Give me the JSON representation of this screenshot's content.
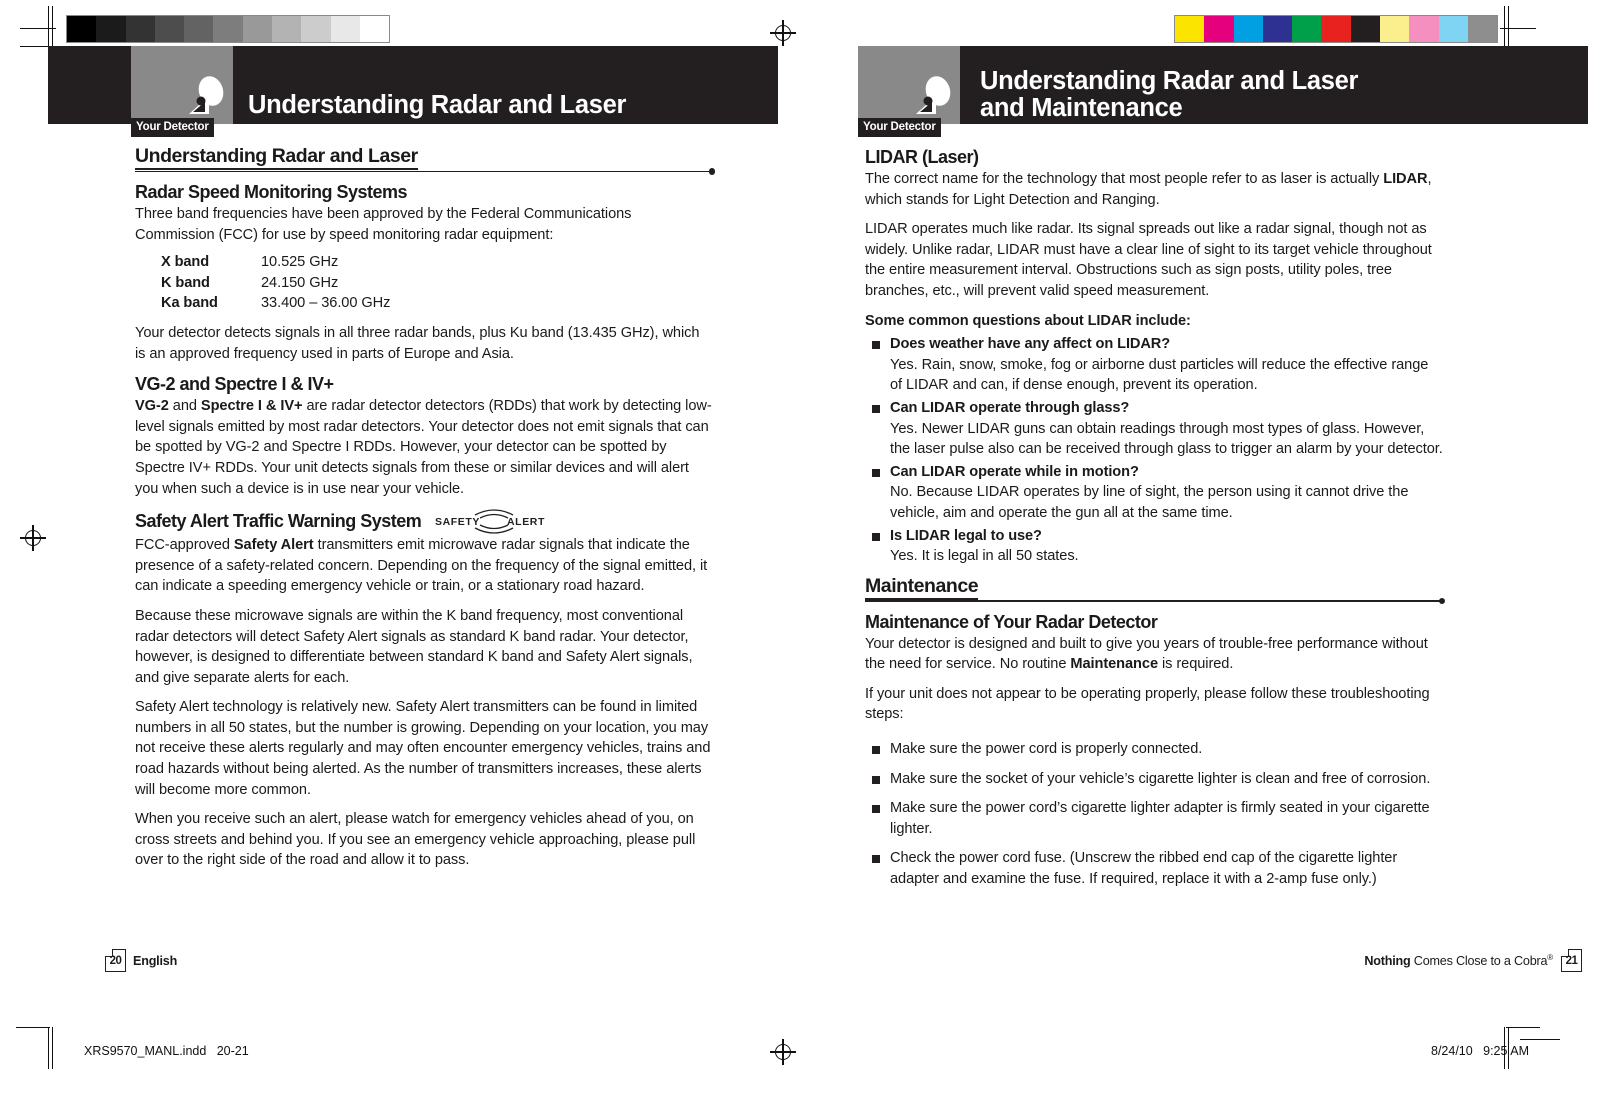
{
  "print_marks": {
    "grayscale_swatches": [
      "#000000",
      "#1b1b1b",
      "#333333",
      "#4d4d4d",
      "#636363",
      "#7d7d7d",
      "#999999",
      "#b3b3b3",
      "#cccccc",
      "#e8e8e8",
      "#ffffff"
    ],
    "color_swatches": [
      "#fbe400",
      "#e5007e",
      "#00a0e2",
      "#2e3191",
      "#00a04b",
      "#e8231f",
      "#231f20",
      "#fbef8d",
      "#f48fc0",
      "#7fd4f4",
      "#8e8e8e"
    ],
    "file_label": "XRS9570_MANL.indd   20-21",
    "date_label": "8/24/10   9:25 AM"
  },
  "left_page": {
    "tab_label": "Your Detector",
    "banner_title": "Understanding Radar and Laser",
    "section_title": "Understanding Radar and Laser",
    "h_radar": "Radar Speed Monitoring Systems",
    "p_radar_intro": "Three band frequencies have been approved by the Federal Communications Commission (FCC) for use by speed monitoring radar equipment:",
    "bands": [
      {
        "name": "X band",
        "freq": "10.525 GHz"
      },
      {
        "name": "K band",
        "freq": "24.150 GHz"
      },
      {
        "name": "Ka band",
        "freq": "33.400 – 36.00 GHz"
      }
    ],
    "p_bands_note": "Your detector detects signals in all three radar bands, plus Ku band (13.435 GHz), which is an approved frequency used in parts of Europe and Asia.",
    "h_vg2": "VG-2 and Spectre I & IV+",
    "p_vg2_a": "VG-2",
    "p_vg2_b": " and ",
    "p_vg2_c": "Spectre I & IV+",
    "p_vg2_d": " are radar detector detectors (RDDs) that work by detecting low-level signals emitted by most radar detectors. Your detector does not emit signals that can be spotted by VG-2 and Spectre I RDDs. However, your detector can be spotted by Spectre IV+ RDDs. Your unit detects signals from these or similar devices and will alert you when such a device is in use near your vehicle.",
    "h_safety": "Safety Alert Traffic Warning System",
    "safety_logo_text": "SAFETY ALERT",
    "p_safety_a": "FCC-approved ",
    "p_safety_b": "Safety Alert",
    "p_safety_c": " transmitters emit microwave radar signals that indicate the presence of a safety-related concern. Depending on the frequency of the signal emitted, it can indicate a speeding emergency vehicle or train, or a stationary road hazard.",
    "p_safety_2": "Because these microwave signals are within the K band frequency, most conventional radar detectors will detect Safety Alert signals as standard K band radar. Your detector, however, is designed to differentiate between standard K band and Safety Alert signals, and give separate alerts for each.",
    "p_safety_3": "Safety Alert technology is relatively new. Safety Alert transmitters can be found in limited numbers in all 50 states, but the number is growing. Depending on your location, you may not receive these alerts regularly and may often encounter emergency vehicles, trains and road hazards without being alerted. As the number of transmitters increases, these alerts will become more common.",
    "p_safety_4": "When you receive such an alert, please watch for emergency vehicles ahead of you, on cross streets and behind you. If you see an emergency vehicle approaching, please pull over to the right side of the road and allow it to pass.",
    "page_number": "20",
    "language": "English"
  },
  "right_page": {
    "tab_label": "Your Detector",
    "banner_title": "Understanding Radar and Laser\nand Maintenance",
    "h_lidar": "LIDAR (Laser)",
    "p_lidar_a": "The correct name for the technology that most people refer to as laser is actually ",
    "p_lidar_b": "LIDAR",
    "p_lidar_c": ", which stands for Light Detection and Ranging.",
    "p_lidar_2": "LIDAR operates much like radar. Its signal spreads out like a radar signal, though not as widely. Unlike radar, LIDAR must have a clear line of sight to its target vehicle throughout the entire measurement interval. Obstructions such as sign posts, utility poles, tree branches, etc., will prevent valid speed measurement.",
    "h_questions": "Some common questions about LIDAR include:",
    "questions": [
      {
        "q": "Does weather have any affect on LIDAR?",
        "a": "Yes. Rain, snow, smoke, fog or airborne dust particles will reduce the effective range of LIDAR and can, if dense enough, prevent its operation."
      },
      {
        "q": "Can LIDAR operate through glass?",
        "a": "Yes. Newer LIDAR guns can obtain readings through most types of glass. However, the laser pulse also can be received through glass to trigger an alarm by your detector."
      },
      {
        "q": "Can LIDAR operate while in motion?",
        "a": "No. Because LIDAR operates by line of sight, the person using it cannot drive the vehicle, aim and operate the gun all at the same time."
      },
      {
        "q": "Is LIDAR legal to use?",
        "a": "Yes. It is legal in all 50 states."
      }
    ],
    "section_title": "Maintenance",
    "h_maint": "Maintenance of Your Radar Detector",
    "p_maint_a": "Your detector is designed and built to give you years of trouble-free performance without the need for service. No routine ",
    "p_maint_b": "Maintenance",
    "p_maint_c": " is required.",
    "p_maint_2": "If your unit does not appear to be operating properly, please follow these troubleshooting steps:",
    "steps": [
      "Make sure the power cord is properly connected.",
      "Make sure the socket of your vehicle’s cigarette lighter is clean and free of corrosion.",
      "Make sure the power cord’s cigarette lighter adapter is firmly seated in your cigarette lighter.",
      "Check the power cord fuse. (Unscrew the ribbed end cap of the cigarette lighter adapter and examine the fuse. If required, replace it with a 2-amp fuse only.)"
    ],
    "tagline_bold": "Nothing",
    "tagline_rest": " Comes Close to a Cobra",
    "tagline_sup": "®",
    "page_number": "21"
  }
}
